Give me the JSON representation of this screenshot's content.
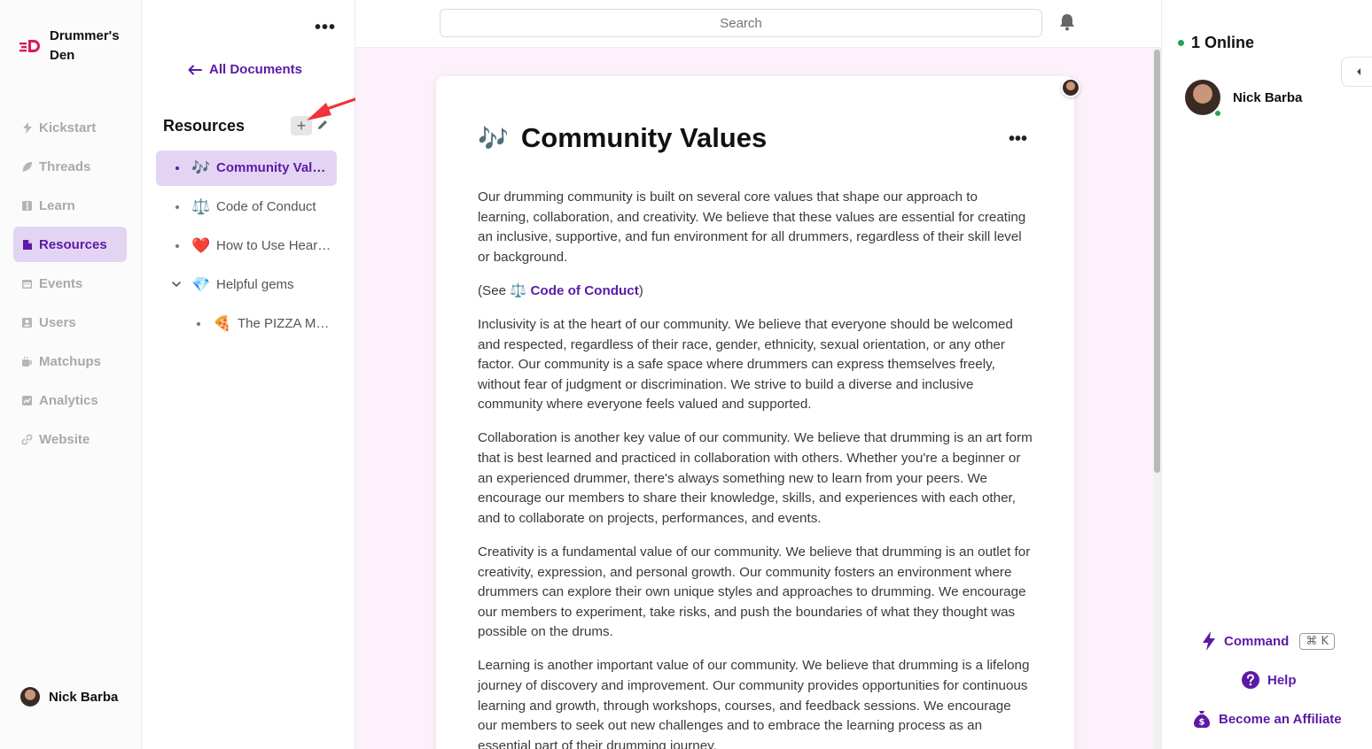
{
  "brand": {
    "name": "Drummer's Den",
    "accent": "#5b1aa6",
    "logo_color": "#d81b60"
  },
  "nav": {
    "items": [
      {
        "label": "Kickstart",
        "icon": "bolt-icon"
      },
      {
        "label": "Threads",
        "icon": "feather-icon"
      },
      {
        "label": "Learn",
        "icon": "book-icon"
      },
      {
        "label": "Resources",
        "icon": "document-icon",
        "active": true
      },
      {
        "label": "Events",
        "icon": "calendar-icon"
      },
      {
        "label": "Users",
        "icon": "user-card-icon"
      },
      {
        "label": "Matchups",
        "icon": "mug-icon"
      },
      {
        "label": "Analytics",
        "icon": "chart-icon"
      },
      {
        "label": "Website",
        "icon": "link-icon"
      }
    ],
    "user": "Nick Barba"
  },
  "docs": {
    "back_label": "All Documents",
    "section_title": "Resources",
    "items": [
      {
        "emoji": "🎶",
        "label": "Community Values",
        "active": true
      },
      {
        "emoji": "⚖️",
        "label": "Code of Conduct"
      },
      {
        "emoji": "❤️",
        "label": "How to Use Heartbeat"
      },
      {
        "emoji": "💎",
        "label": "Helpful gems",
        "expanded": true
      },
      {
        "emoji": "🍕",
        "label": "The PIZZA Method",
        "child": true
      }
    ]
  },
  "topbar": {
    "search_placeholder": "Search"
  },
  "document": {
    "emoji": "🎶",
    "title": "Community Values",
    "p1": "Our drumming community is built on several core values that shape our approach to learning, collaboration, and creativity. We believe that these values are essential for creating an inclusive, supportive, and fun environment for all drummers, regardless of their skill level or background.",
    "see_prefix": "(See ",
    "see_emoji": "⚖️",
    "see_link": "Code of Conduct",
    "see_suffix": ")",
    "p2": "Inclusivity is at the heart of our community. We believe that everyone should be welcomed and respected, regardless of their race, gender, ethnicity, sexual orientation, or any other factor. Our community is a safe space where drummers can express themselves freely, without fear of judgment or discrimination. We strive to build a diverse and inclusive community where everyone feels valued and supported.",
    "p3": "Collaboration is another key value of our community. We believe that drumming is an art form that is best learned and practiced in collaboration with others. Whether you're a beginner or an experienced drummer, there's always something new to learn from your peers. We encourage our members to share their knowledge, skills, and experiences with each other, and to collaborate on projects, performances, and events.",
    "p4": "Creativity is a fundamental value of our community. We believe that drumming is an outlet for creativity, expression, and personal growth. Our community fosters an environment where drummers can explore their own unique styles and approaches to drumming. We encourage our members to experiment, take risks, and push the boundaries of what they thought was possible on the drums.",
    "p5": "Learning is another important value of our community. We believe that drumming is a lifelong journey of discovery and improvement. Our community provides opportunities for continuous learning and growth, through workshops, courses, and feedback sessions. We encourage our members to seek out new challenges and to embrace the learning process as an essential part of their drumming journey."
  },
  "right": {
    "online_label": "1 Online",
    "online_user": "Nick Barba",
    "command_label": "Command",
    "command_shortcut": "⌘ K",
    "help_label": "Help",
    "affiliate_label": "Become an Affiliate"
  }
}
